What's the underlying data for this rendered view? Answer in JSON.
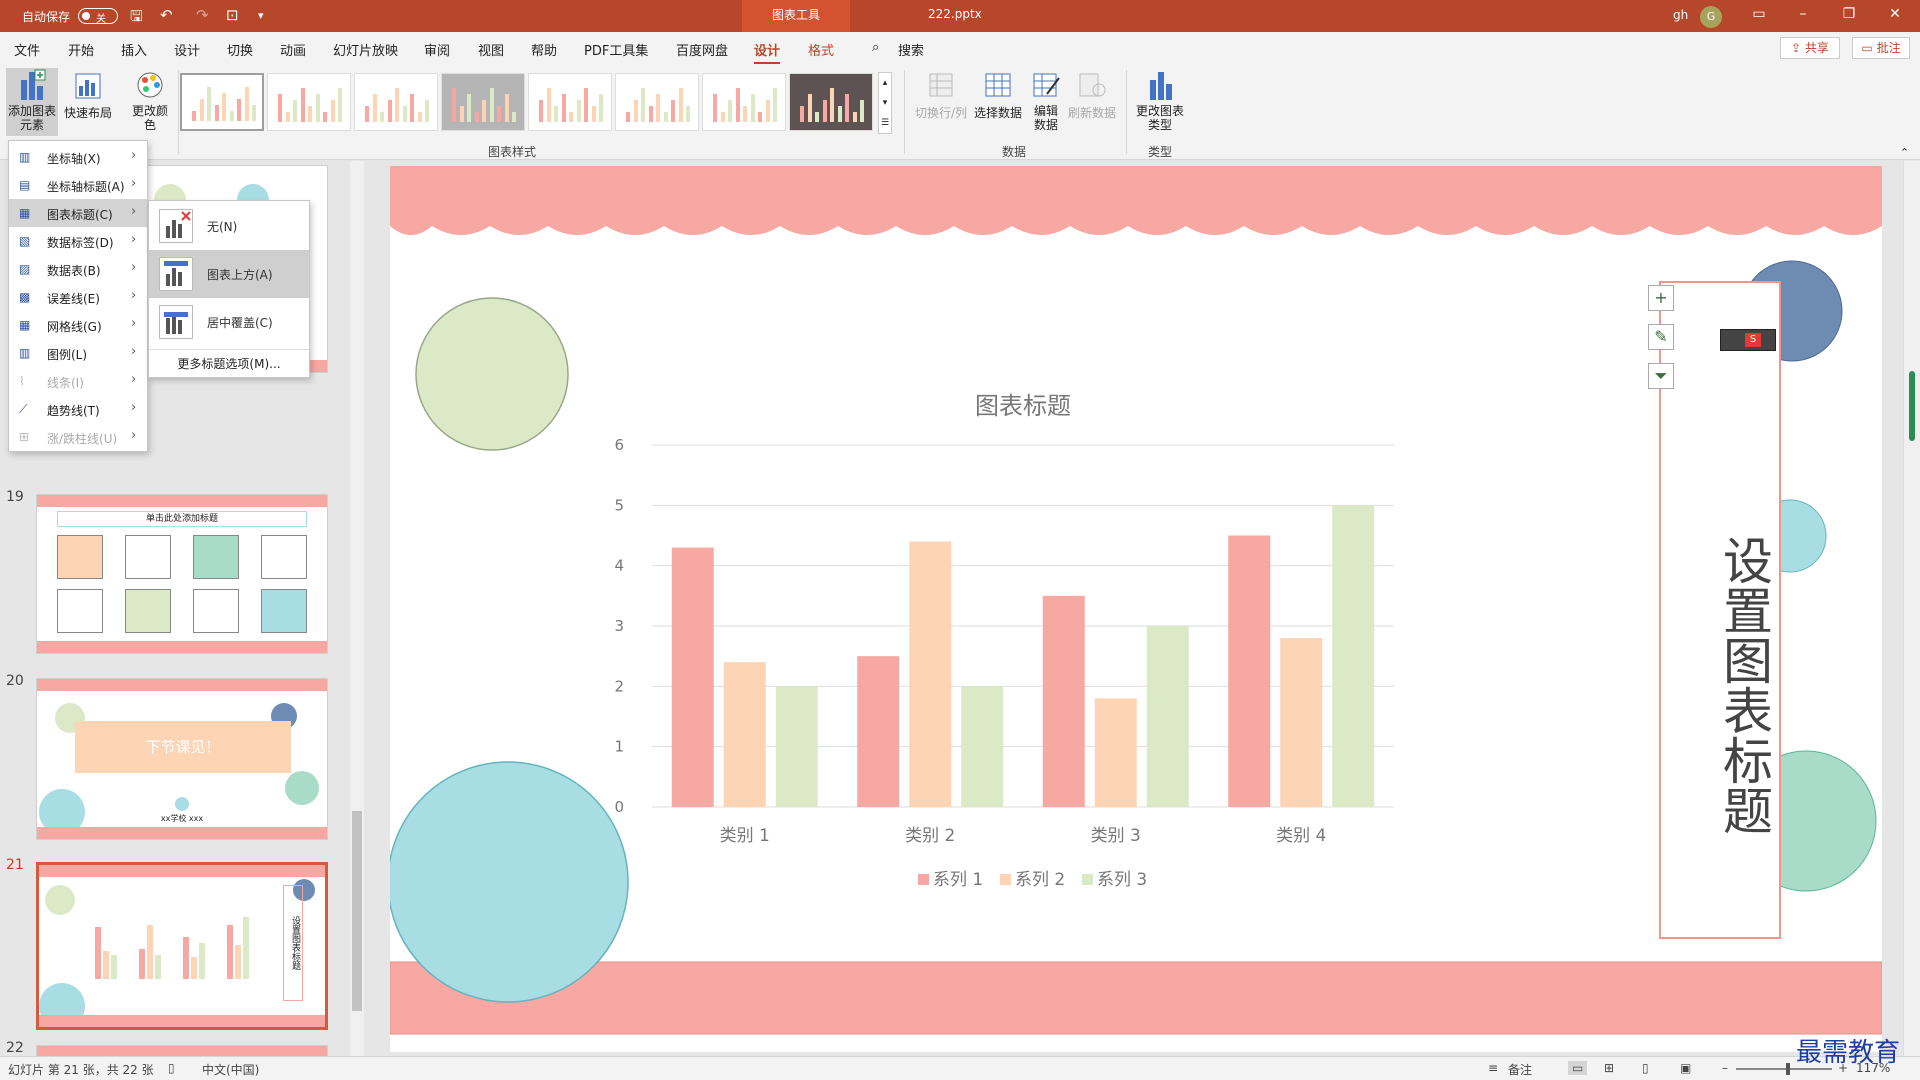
{
  "titlebar": {
    "autosave": "自动保存",
    "toggle_state": "关",
    "tool_tab": "图表工具",
    "filename": "222.pptx",
    "user": "gh",
    "avatar": "G"
  },
  "menu": {
    "items": [
      "文件",
      "开始",
      "插入",
      "设计",
      "切换",
      "动画",
      "幻灯片放映",
      "审阅",
      "视图",
      "帮助",
      "PDF工具集",
      "百度网盘",
      "设计",
      "格式"
    ],
    "search": "搜索",
    "share": "共享",
    "comment": "批注"
  },
  "ribbon": {
    "add_chart_element": "添加图表元素",
    "quick_layout": "快速布局",
    "change_colors": "更改颜色",
    "chart_styles_label": "图表样式",
    "switch_row_col": "切换行/列",
    "select_data": "选择数据",
    "edit_data": "编辑数据",
    "refresh_data": "刷新数据",
    "data_label": "数据",
    "change_chart_type": "更改图表类型",
    "type_label": "类型"
  },
  "dropdown": {
    "items": [
      {
        "label": "坐标轴(X)",
        "disabled": false
      },
      {
        "label": "坐标轴标题(A)",
        "disabled": false
      },
      {
        "label": "图表标题(C)",
        "disabled": false
      },
      {
        "label": "数据标签(D)",
        "disabled": false
      },
      {
        "label": "数据表(B)",
        "disabled": false
      },
      {
        "label": "误差线(E)",
        "disabled": false
      },
      {
        "label": "网格线(G)",
        "disabled": false
      },
      {
        "label": "图例(L)",
        "disabled": false
      },
      {
        "label": "线条(I)",
        "disabled": true
      },
      {
        "label": "趋势线(T)",
        "disabled": false
      },
      {
        "label": "涨/跌柱线(U)",
        "disabled": true
      }
    ],
    "submenu": [
      "无(N)",
      "图表上方(A)",
      "居中覆盖(C)"
    ],
    "more_options": "更多标题选项(M)..."
  },
  "slides": {
    "numbers": [
      "19",
      "20",
      "21",
      "22"
    ],
    "thumb19_title": "单击此处添加标题",
    "thumb20_text": "下节课见！",
    "thumb20_school": "xx学校 xxx"
  },
  "slide": {
    "vertical_title": "设置图表标题"
  },
  "chart_data": {
    "type": "bar",
    "title": "图表标题",
    "categories": [
      "类别 1",
      "类别 2",
      "类别 3",
      "类别 4"
    ],
    "series": [
      {
        "name": "系列 1",
        "values": [
          4.3,
          2.5,
          3.5,
          4.5
        ],
        "color": "#f8a8a2"
      },
      {
        "name": "系列 2",
        "values": [
          2.4,
          4.4,
          1.8,
          2.8
        ],
        "color": "#fdd4b4"
      },
      {
        "name": "系列 3",
        "values": [
          2.0,
          2.0,
          3.0,
          5.0
        ],
        "color": "#dbe9c6"
      }
    ],
    "yticks": [
      "0",
      "1",
      "2",
      "3",
      "4",
      "5",
      "6"
    ],
    "ylim": [
      0,
      6
    ],
    "grid": true,
    "legend": "bottom"
  },
  "status": {
    "slide_info": "幻灯片 第 21 张，共 22 张",
    "language": "中文(中国)",
    "notes": "备注",
    "zoom": "117%"
  },
  "watermark": "最需教育"
}
